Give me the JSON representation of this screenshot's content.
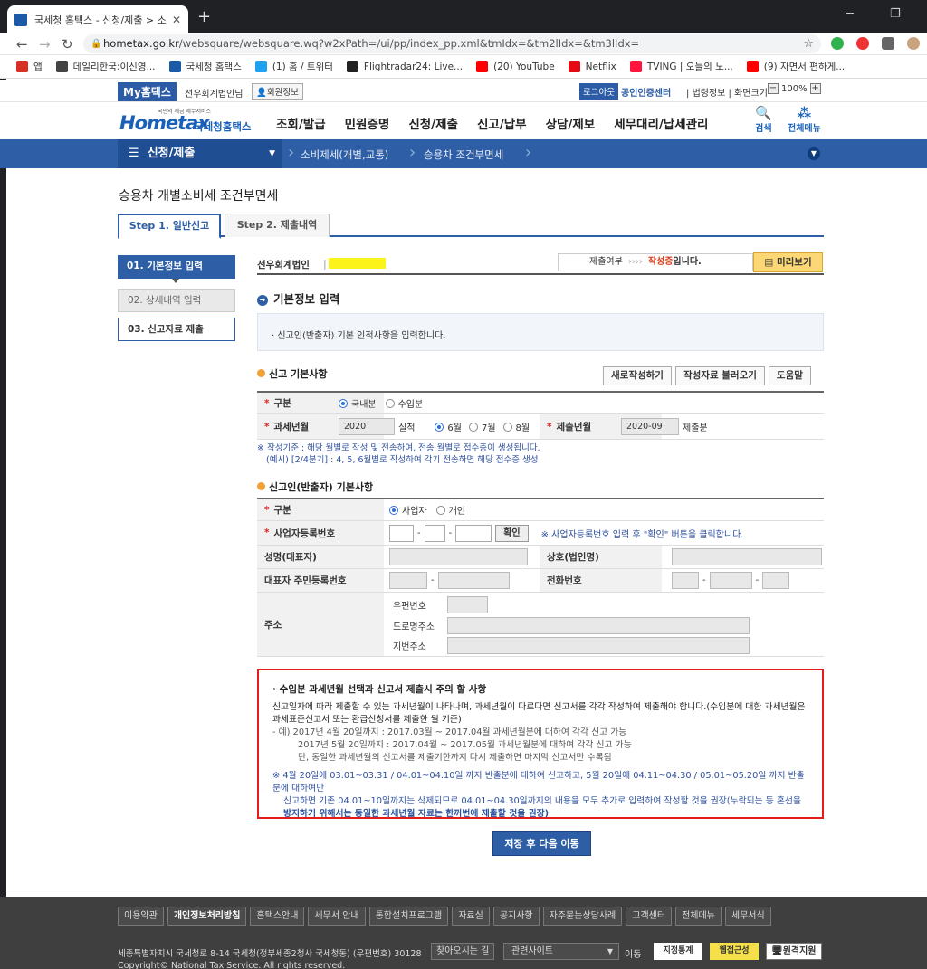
{
  "browser": {
    "tab_title": "국세청 홈택스 - 신청/제출 > 소",
    "url_host": "hometax.go.kr",
    "url_path": "/websquare/websquare.wq?w2xPath=/ui/pp/index_pp.xml&tmIdx=&tm2lIdx=&tm3lIdx=",
    "bookmarks": [
      {
        "label": "앱",
        "icon": "apps-grid-icon",
        "color": "#d93025"
      },
      {
        "label": "데일리한국:이신영...",
        "icon": "globe-icon",
        "color": "#444444"
      },
      {
        "label": "국세청 홈택스",
        "icon": "hometax-icon",
        "color": "#1a5aa6"
      },
      {
        "label": "(1) 홈 / 트위터",
        "icon": "twitter-icon",
        "color": "#1da1f2"
      },
      {
        "label": "Flightradar24: Live...",
        "icon": "flightradar-icon",
        "color": "#222222"
      },
      {
        "label": "(20) YouTube",
        "icon": "youtube-icon",
        "color": "#ff0000"
      },
      {
        "label": "Netflix",
        "icon": "netflix-icon",
        "color": "#e50914"
      },
      {
        "label": "TVING | 오늘의 노...",
        "icon": "tving-icon",
        "color": "#ff153c"
      },
      {
        "label": "(9) 자면서 편하게...",
        "icon": "youtube-icon",
        "color": "#ff0000"
      }
    ]
  },
  "util": {
    "my_hometax": "My홈택스",
    "user": "선우회계법인님",
    "user_info": "회원정보",
    "login": "로그아웃",
    "cert": "공인인증센터",
    "law": "법령정보",
    "screen": "화면크기",
    "zoom": "100%"
  },
  "header": {
    "logo_tag": "국민의 세금 세무서비스",
    "logo_main": "Hometax",
    "logo_kr": "국세청홈택스",
    "menu": [
      "조회/발급",
      "민원증명",
      "신청/제출",
      "신고/납부",
      "상담/제보",
      "세무대리/납세관리"
    ],
    "search": "검색",
    "all_menu": "전체메뉴"
  },
  "location": {
    "l1": "신청/제출",
    "l2": "소비제세(개별,교통)",
    "l3": "승용차 조건부면세"
  },
  "page": {
    "title": "승용차 개별소비세 조건부면세",
    "tabs": [
      "Step 1. 일반신고",
      "Step 2. 제출내역"
    ],
    "steps": [
      "01. 기본정보 입력",
      "02. 상세내역 입력",
      "03. 신고자료 제출"
    ],
    "company": "선우회계법인",
    "submit_status_label": "제출여부",
    "submit_status_value": "작성중",
    "submit_status_suffix": "입니다.",
    "preview": "미리보기",
    "section_title": "기본정보 입력",
    "info_text": "신고인(반출자) 기본 인적사항을 입력합니다.",
    "report_basic": "신고 기본사항",
    "btn_new": "새로작성하기",
    "btn_load": "작성자료 불러오기",
    "btn_help": "도움말",
    "gubun_label": "구분",
    "gubun_opt1": "국내분",
    "gubun_opt2": "수입분",
    "period_label": "과세년월",
    "period_year": "2020",
    "period_suffix": "실적",
    "months": [
      "6월",
      "7월",
      "8월"
    ],
    "submit_ym_label": "제출년월",
    "submit_ym": "2020-09",
    "submit_ym_suffix": "제출분",
    "note1": "※ 작성기준 : 해당 월별로 작성 및 전송하여, 전송 월별로 접수증이 생성됩니다.",
    "note2": "(예시) [2/4분기] : 4, 5, 6월별로 작성하여 각기 전송하면 해당 접수증 생성",
    "reporter_basic": "신고인(반출자) 기본사항",
    "rep_gubun_opt1": "사업자",
    "rep_gubun_opt2": "개인",
    "biz_no_label": "사업자등록번호",
    "confirm": "확인",
    "biz_note": "※ 사업자등록번호 입력 후 \"확인\" 버튼을 클릭합니다.",
    "name_label": "성명(대표자)",
    "trade_label": "상호(법인명)",
    "rrn_label": "대표자 주민등록번호",
    "phone_label": "전화번호",
    "addr_label": "주소",
    "zip_label": "우편번호",
    "road_label": "도로명주소",
    "jibun_label": "지번주소",
    "warn_title": "수입분 과세년월 선택과 신고서 제출시 주의 할 사항",
    "warn_p1": "신고일자에 따라 제출할 수 있는 과세년월이 나타나며, 과세년월이 다르다면 신고서를 각각 작성하여 제출해야 합니다.(수입분에 대한 과세년월은 과세표준신고서 또는 환급신청서를 제출한 월 기준)",
    "warn_e1": "- 예) 2017년 4월 20일까지 : 2017.03월 ~ 2017.04월 과세년월분에 대하여 각각 신고 가능",
    "warn_e2": "2017년 5월 20일까지 : 2017.04월 ~ 2017.05월 과세년월분에 대하여 각각 신고 가능",
    "warn_e3": "단, 동일한 과세년월의 신고서를 제출기한까지 다시 제출하면 마지막 신고서만 수록됨",
    "warn_b1": "※ 4월 20일에 03.01~03.31 / 04.01~04.10일 까지 반출분에 대하여 신고하고, 5월 20일에 04.11~04.30 / 05.01~05.20일 까지 반출분에 대하여만",
    "warn_b2": "신고하면 기존 04.01~10일까지는 삭제되므로 04.01~04.30일까지의 내용을 모두 추가로 입력하여 작성할 것을 권장(누락되는 등 혼선을",
    "warn_b3": "방지하기 위해서는 동일한 과세년월 자료는 한꺼번에 제출할 것을 권장)",
    "save_next": "저장 후 다음 이동"
  },
  "footer": {
    "menu": [
      "이용약관",
      "개인정보처리방침",
      "홈택스안내",
      "세무서 안내",
      "통합설치프로그램",
      "자료실",
      "공지사항",
      "자주묻는상담사례",
      "고객센터",
      "전체메뉴",
      "세무서식"
    ],
    "address": "세종특별자치시 국세청로 8-14 국세청(정부세종2청사 국세청동) (우편번호) 30128",
    "directions": "찾아오시는 길",
    "related": "관련사이트",
    "go": "이동",
    "badge1": "지정통계",
    "badge2": "웹접근성",
    "remote": "원격지원",
    "copyright": "Copyright© National Tax Service. All rights reserved."
  }
}
